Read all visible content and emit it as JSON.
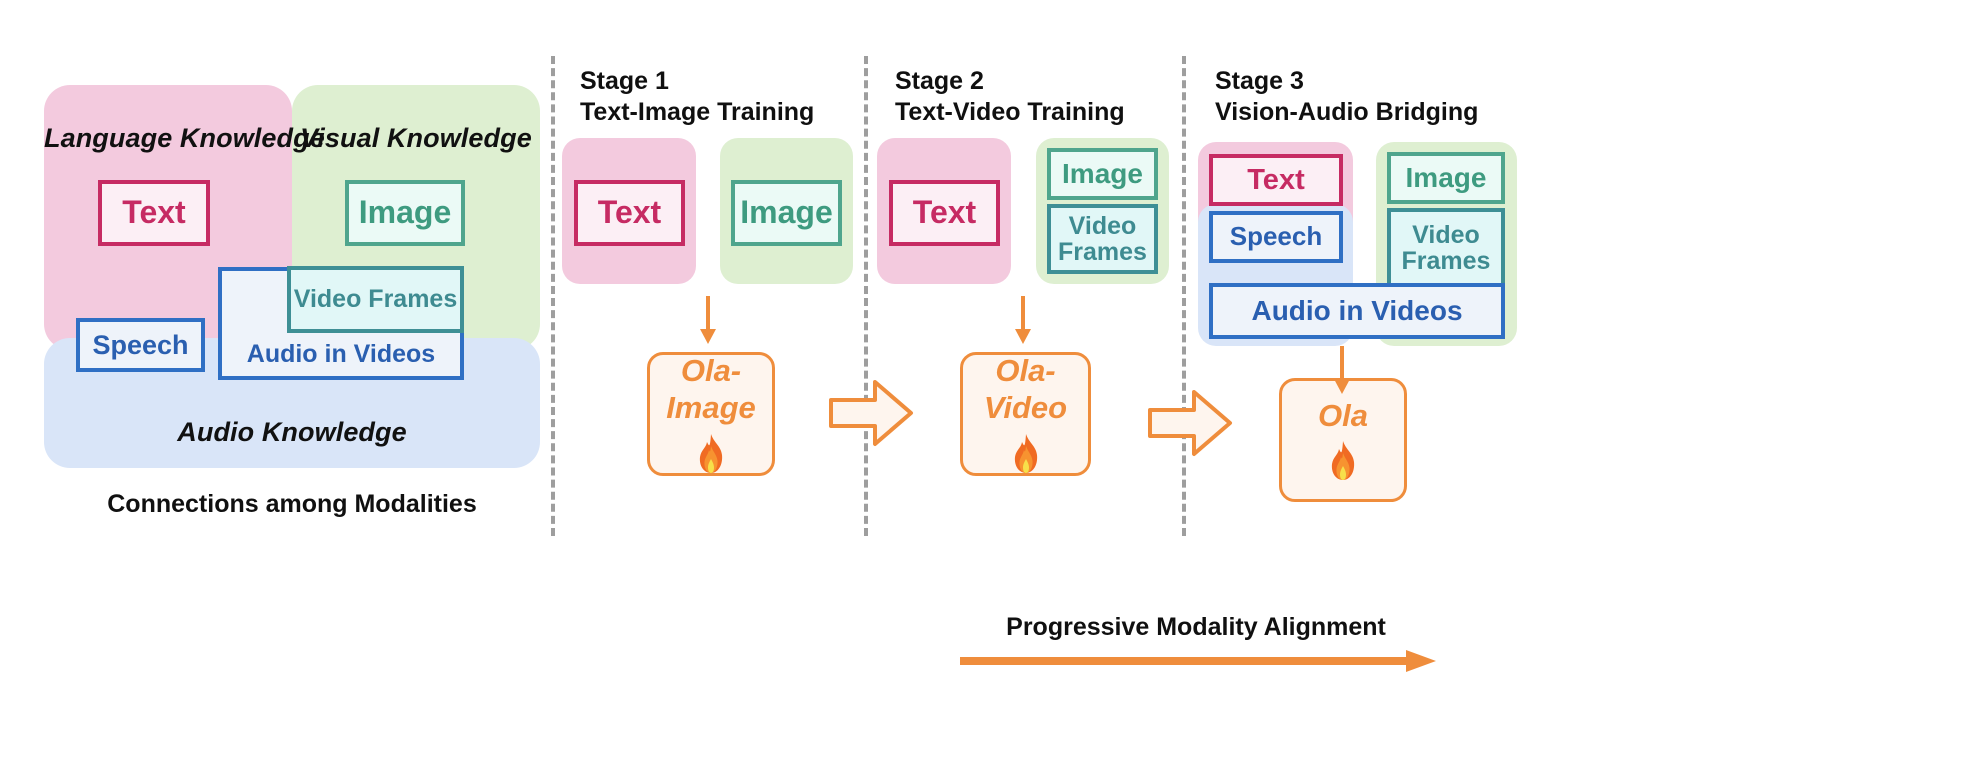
{
  "diagram": {
    "title_left": "Connections among Modalities",
    "title_bottom": "Progressive Modality Alignment"
  },
  "colors": {
    "language_panel": "#F3CADE",
    "visual_panel": "#DEEFD1",
    "audio_panel": "#D9E5F8",
    "text_accent": "#C62B63",
    "image_accent": "#4FA58D",
    "video_accent": "#3E8F95",
    "audio_accent": "#2F6FC4",
    "model_accent": "#EF8D3C",
    "divider": "#9E9E9E"
  },
  "left_panel": {
    "language": {
      "title": "Language Knowledge"
    },
    "visual": {
      "title": "Visual Knowledge"
    },
    "audio": {
      "title": "Audio Knowledge"
    },
    "chips": {
      "text": "Text",
      "image": "Image",
      "video_frames": "Video Frames",
      "speech": "Speech",
      "audio_in_videos": "Audio in Videos"
    }
  },
  "stages": [
    {
      "number": "Stage 1",
      "subtitle": "Text-Image Training",
      "left_chip": "Text",
      "right_chips": [
        "Image"
      ],
      "model": "Ola-\nImage",
      "model_icon": "flame-icon"
    },
    {
      "number": "Stage 2",
      "subtitle": "Text-Video Training",
      "left_chip": "Text",
      "right_chips": [
        "Image",
        "Video\nFrames"
      ],
      "model": "Ola-\nVideo",
      "model_icon": "flame-icon"
    },
    {
      "number": "Stage 3",
      "subtitle": "Vision-Audio Bridging",
      "left_chip": "Text",
      "speech_chip": "Speech",
      "audio_chip": "Audio in Videos",
      "right_chips": [
        "Image",
        "Video\nFrames"
      ],
      "model": "Ola",
      "model_icon": "flame-icon"
    }
  ]
}
